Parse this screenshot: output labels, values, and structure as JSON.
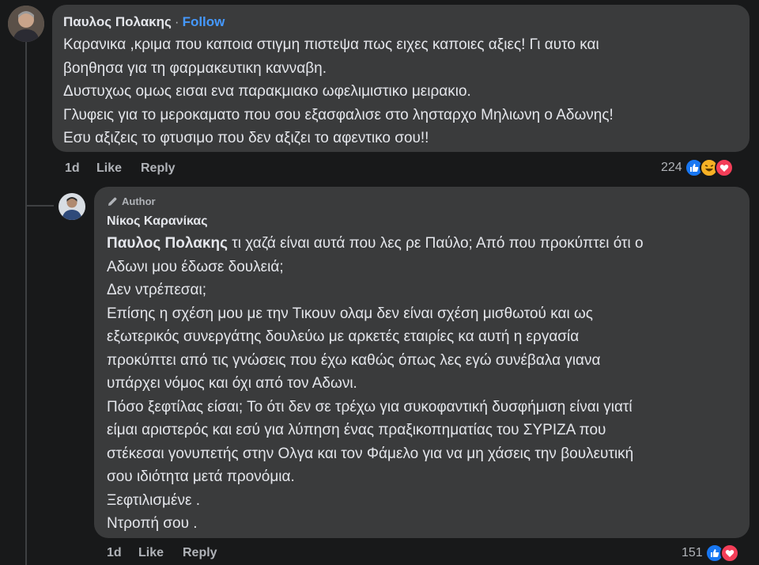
{
  "comment1": {
    "author": "Παυλος Πολακης",
    "separator": "·",
    "follow_label": "Follow",
    "lines": [
      "Καρανικα ,κριμα που καποια στιγμη πιστεψα πως ειχες καποιες αξιες! Γι αυτο και",
      "βοηθησα για τη φαρμακευτικη κανναβη.",
      "Δυστυχως ομως εισαι ενα παρακμιακο ωφελιμιστικο μειρακιο.",
      "Γλυφεις για το μεροκαματο που σου εξασφαλισε στο λησταρχο Μηλιωνη ο Αδωνης!",
      "Εσυ αξιζεις το φτυσιμο που δεν αξιζει το αφεντικο σου!!"
    ],
    "time": "1d",
    "like_label": "Like",
    "reply_label": "Reply",
    "reaction_count": "224",
    "reactions": [
      "like-icon",
      "haha-icon",
      "love-icon"
    ]
  },
  "comment2": {
    "badge": "Author",
    "author": "Νίκος Καρανίκας",
    "mention": "Παυλος Πολακης",
    "first_line_rest": " τι χαζά είναι αυτά που λες ρε Παύλο; Από που προκύπτει ότι ο",
    "lines": [
      "Αδωνι μου έδωσε δουλειά;",
      "Δεν ντρέπεσαι;",
      "Επίσης η σχέση μου με την Τικουν ολαμ δεν είναι σχέση μισθωτού και ως",
      "εξωτερικός συνεργάτης δουλεύω με αρκετές εταιρίες κα αυτή η εργασία",
      "προκύπτει από τις γνώσεις που έχω καθώς όπως λες εγώ συνέβαλα γιανα",
      "υπάρχει νόμος και όχι από τον Αδωνι.",
      "Πόσο ξεφτίλας είσαι; Το ότι δεν σε τρέχω για συκοφαντική δυσφήμιση είναι γιατί",
      "είμαι αριστερός και εσύ για λύπηση ένας πραξικοπηματίας του ΣΥΡΙΖΑ που",
      "στέκεσαι γονυπετής στην Ολγα και τον Φάμελο για να μη χάσεις την βουλευτική",
      "σου ιδιότητα μετά προνόμια.",
      "Ξεφτιλισμένε .",
      "Ντροπή σου ."
    ],
    "time": "1d",
    "like_label": "Like",
    "reply_label": "Reply",
    "reaction_count": "151",
    "reactions": [
      "like-icon",
      "love-icon"
    ]
  },
  "colors": {
    "background": "#18191a",
    "bubble": "#3a3b3c",
    "follow": "#4599ff",
    "like": "#1877f2",
    "love": "#f33e58",
    "haha": "#f7b125"
  }
}
